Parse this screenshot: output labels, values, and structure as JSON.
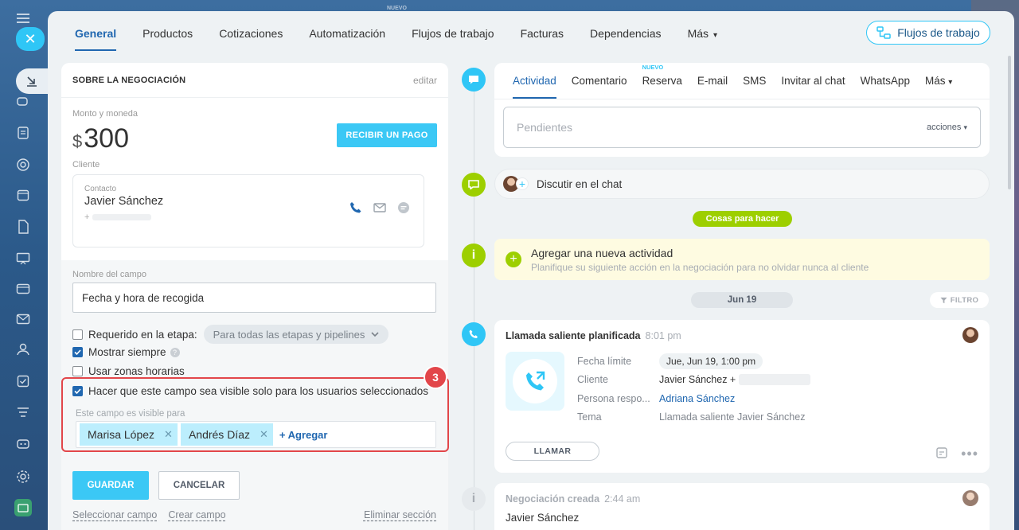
{
  "top_tabs": [
    {
      "label": "General"
    },
    {
      "label": "Productos"
    },
    {
      "label": "Cotizaciones"
    },
    {
      "label": "Automatización"
    },
    {
      "label": "Flujos de trabajo"
    },
    {
      "label": "Facturas"
    },
    {
      "label": "Dependencias"
    },
    {
      "label": "Más"
    }
  ],
  "top_new_badge": "NUEVO",
  "flow_button": "Flujos de trabajo",
  "deal": {
    "section_title": "SOBRE LA NEGOCIACIÓN",
    "edit_label": "editar",
    "amount_label": "Monto y moneda",
    "currency": "$",
    "amount": "300",
    "pay_button": "RECIBIR UN PAGO",
    "client_label": "Cliente",
    "contact_label": "Contacto",
    "contact_name": "Javier Sánchez",
    "contact_phone_prefix": "+"
  },
  "field_editor": {
    "name_label": "Nombre del campo",
    "name_value": "Fecha y hora de recogida",
    "required_label": "Requerido en la etapa:",
    "stage_select": "Para todas las etapas y pipelines",
    "show_always_label": "Mostrar siempre",
    "timezones_label": "Usar zonas horarias",
    "visible_only_label": "Hacer que este campo sea visible solo para los usuarios seleccionados",
    "visible_for_label": "Este campo es visible para",
    "users": [
      "Marisa López",
      "Andrés Díaz"
    ],
    "add_label": "+ Agregar",
    "save_button": "GUARDAR",
    "cancel_button": "CANCELAR",
    "select_field_link": "Seleccionar campo",
    "create_field_link": "Crear campo",
    "delete_section_link": "Eliminar sección",
    "step_badge": "3"
  },
  "activity": {
    "tabs": [
      {
        "label": "Actividad"
      },
      {
        "label": "Comentario"
      },
      {
        "label": "Reserva"
      },
      {
        "label": "E-mail"
      },
      {
        "label": "SMS"
      },
      {
        "label": "Invitar al chat"
      },
      {
        "label": "WhatsApp"
      },
      {
        "label": "Más"
      }
    ],
    "new_tag": "NUEVO",
    "pending_placeholder": "Pendientes",
    "actions_label": "acciones"
  },
  "timeline": {
    "chat_label": "Discutir en el chat",
    "todo_pill": "Cosas para hacer",
    "todo_title": "Agregar una nueva actividad",
    "todo_subtitle": "Planifique su siguiente acción en la negociación para no olvidar nunca al cliente",
    "date_pill": "Jun 19",
    "filter_label": "FILTRO",
    "call": {
      "title": "Llamada saliente planificada",
      "time": "8:01 pm",
      "rows": [
        {
          "key": "Fecha límite",
          "value": "Jue, Jun 19, 1:00 pm"
        },
        {
          "key": "Cliente",
          "value": "Javier Sánchez +"
        },
        {
          "key": "Persona respo...",
          "value": "Adriana Sánchez"
        },
        {
          "key": "Tema",
          "value": "Llamada saliente Javier Sánchez"
        }
      ],
      "call_button": "LLAMAR"
    },
    "created": {
      "title": "Negociación creada",
      "time": "2:44 am",
      "name": "Javier Sánchez"
    }
  },
  "colors": {
    "accent": "#2fc6f6",
    "primary_text_link": "#2067b0",
    "highlight_red": "#e2464a",
    "green": "#9dcf00"
  }
}
